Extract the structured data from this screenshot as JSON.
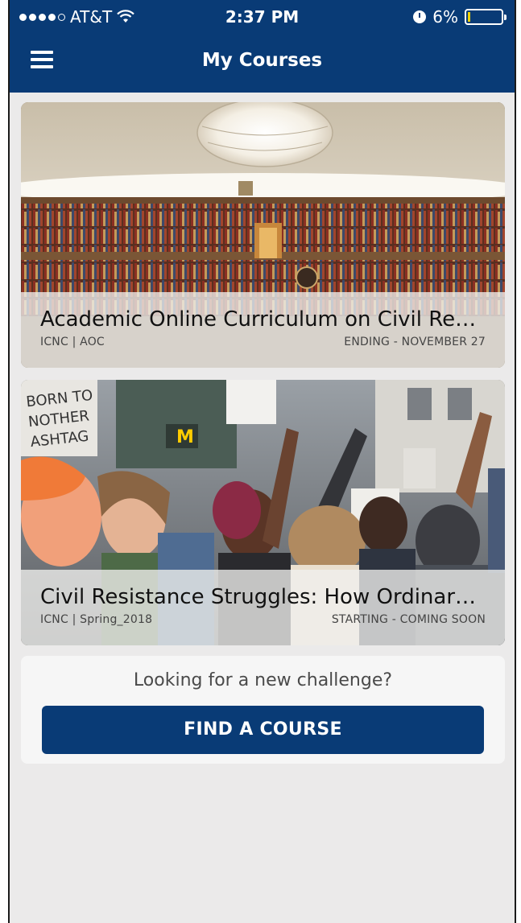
{
  "status_bar": {
    "carrier": "AT&T",
    "time": "2:37 PM",
    "battery_percent": "6%",
    "battery_level": 0.06
  },
  "header": {
    "title": "My Courses",
    "menu_icon": "hamburger-menu-icon"
  },
  "courses": [
    {
      "title": "Academic Online Curriculum on Civil Resis...",
      "org_code": "ICNC | AOC",
      "status": "ENDING - NOVEMBER 27",
      "image": "library-reading-room-photo"
    },
    {
      "title": "Civil Resistance Struggles: How Ordinary P...",
      "org_code": "ICNC | Spring_2018",
      "status": "STARTING - COMING SOON",
      "image": "protest-crowd-photo"
    }
  ],
  "promo": {
    "text": "Looking for a new challenge?",
    "button_label": "FIND A COURSE"
  },
  "colors": {
    "brand": "#093b76",
    "background": "#ebeaea",
    "battery_low": "#f2d400"
  }
}
